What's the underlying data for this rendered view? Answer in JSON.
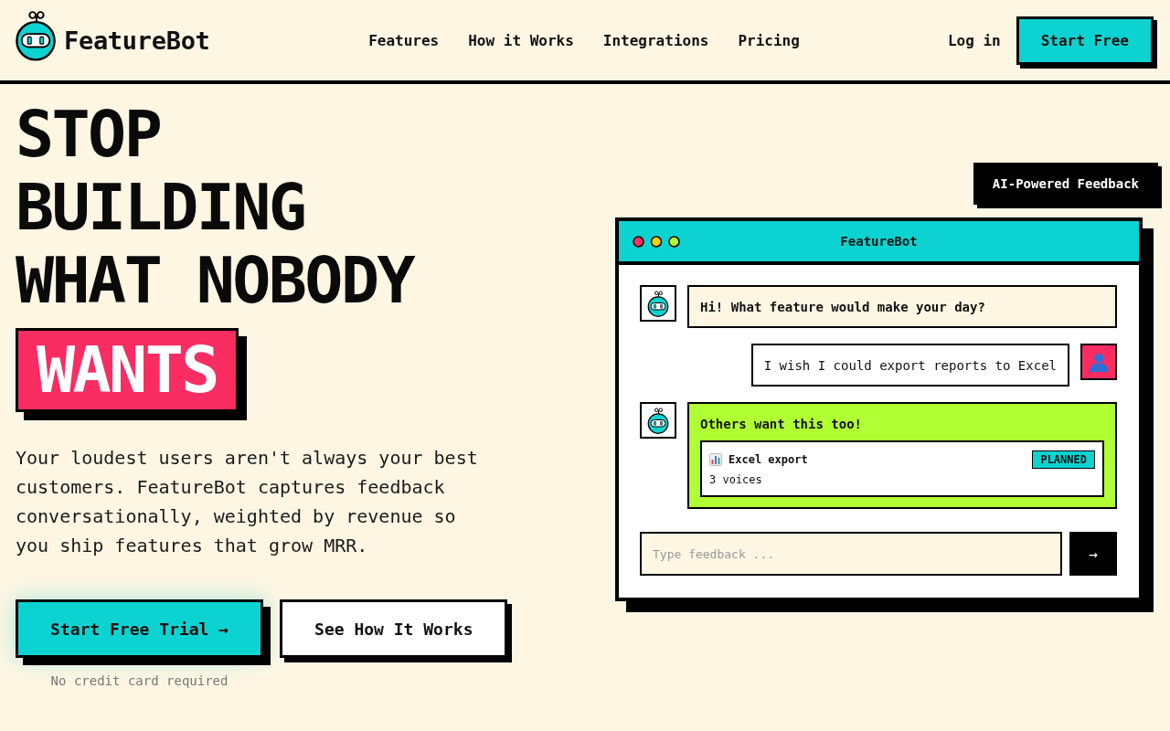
{
  "header": {
    "brand": "FeatureBot",
    "nav": [
      {
        "label": "Features"
      },
      {
        "label": "How it Works"
      },
      {
        "label": "Integrations"
      },
      {
        "label": "Pricing"
      }
    ],
    "login": "Log in",
    "cta": "Start Free"
  },
  "hero": {
    "headline": "STOP BUILDING WHAT NOBODY",
    "highlight": "WANTS",
    "description": "Your loudest users aren't always your best customers. FeatureBot captures feedback conversationally, weighted by revenue so you ship features that grow MRR.",
    "buttons": [
      {
        "kind": "primary",
        "label": "Start Free Trial →",
        "note": "No credit card required"
      },
      {
        "kind": "secondary",
        "label": "See How It Works"
      }
    ]
  },
  "badge": "AI-Powered Feedback",
  "chat": {
    "title": "FeatureBot",
    "messages": [
      {
        "kind": "bot",
        "text": "Hi! What feature would make your day?"
      },
      {
        "kind": "user",
        "text": "I wish I could export reports to Excel"
      },
      {
        "kind": "match",
        "title": "Others want this too!",
        "feature": {
          "name": "Excel export",
          "status": "PLANNED",
          "votes": "3 voices"
        }
      }
    ],
    "input": {
      "placeholder": "Type feedback ..."
    },
    "send": "→"
  }
}
